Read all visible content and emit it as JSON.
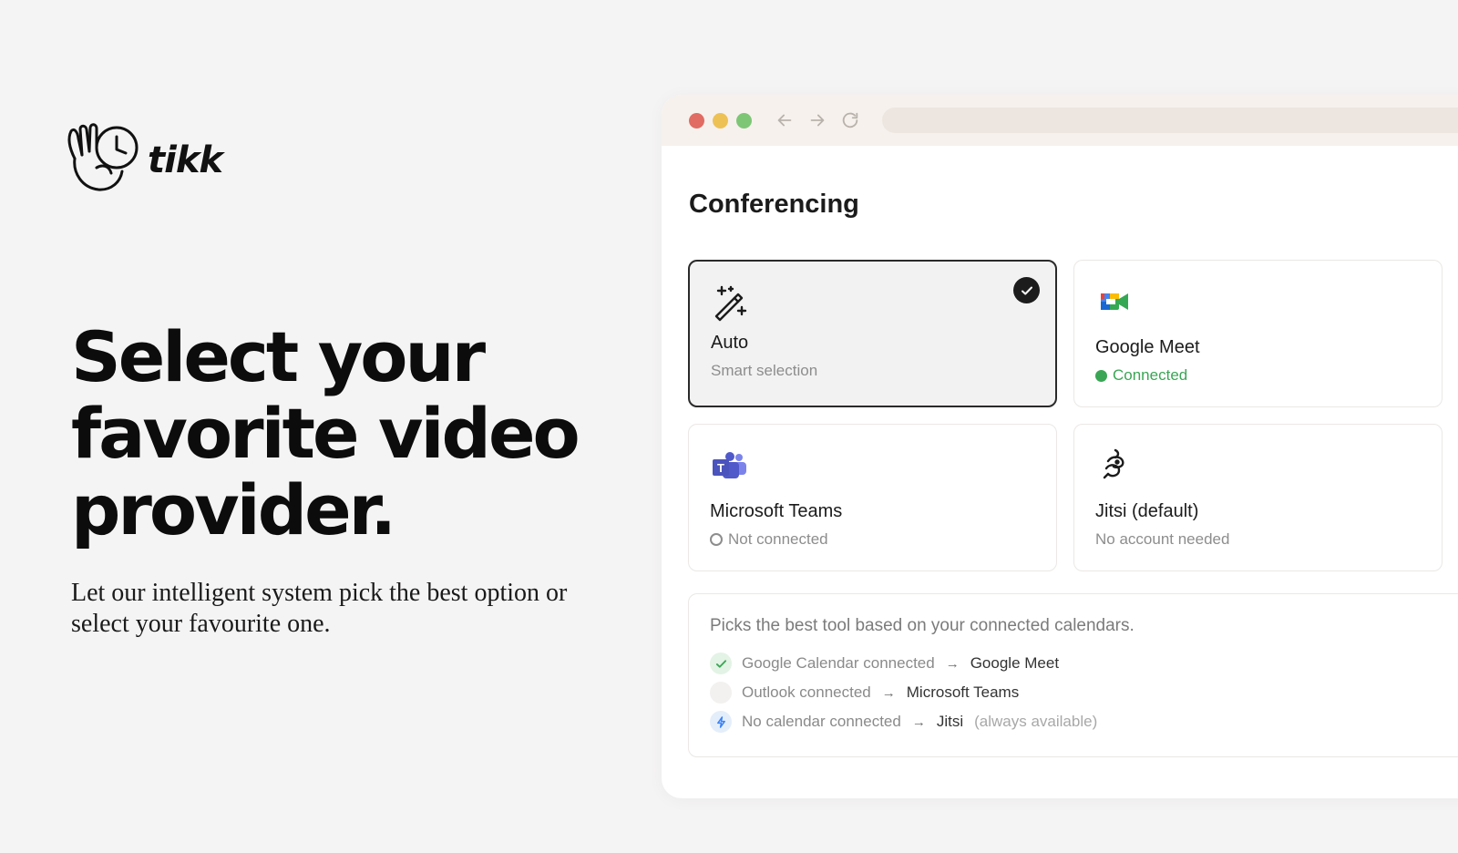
{
  "brand": {
    "name": "tikk"
  },
  "hero": {
    "headline": "Select your favorite video provider.",
    "subtext": "Let our intelligent system pick the best option or select your favourite one."
  },
  "browser": {
    "window_controls": [
      "close",
      "minimize",
      "maximize"
    ],
    "nav_icons": [
      "back-arrow-icon",
      "forward-arrow-icon",
      "reload-icon"
    ]
  },
  "conferencing": {
    "title": "Conferencing",
    "options": [
      {
        "id": "auto",
        "name": "Auto",
        "status": "Smart selection",
        "icon": "magic-wand-icon",
        "selected": true
      },
      {
        "id": "google-meet",
        "name": "Google Meet",
        "status": "Connected",
        "icon": "google-meet-icon",
        "state": "connected"
      },
      {
        "id": "microsoft-teams",
        "name": "Microsoft Teams",
        "status": "Not connected",
        "icon": "microsoft-teams-icon",
        "state": "not-connected"
      },
      {
        "id": "jitsi",
        "name": "Jitsi (default)",
        "status": "No account needed",
        "icon": "jitsi-icon",
        "state": "none"
      }
    ],
    "info": {
      "heading": "Picks the best tool based on your connected calendars.",
      "rules": [
        {
          "condition": "Google Calendar connected",
          "result": "Google Meet",
          "note": "",
          "icon": "check-icon"
        },
        {
          "condition": "Outlook connected",
          "result": "Microsoft Teams",
          "note": "",
          "icon": "empty-circle-icon"
        },
        {
          "condition": "No calendar connected",
          "result": "Jitsi",
          "note": "(always available)",
          "icon": "lightning-icon"
        }
      ]
    }
  },
  "colors": {
    "background": "#f5f4f4",
    "connected": "#3aa655",
    "selected_border": "#2a2a2a",
    "browser_bar": "#f6f1ec"
  }
}
